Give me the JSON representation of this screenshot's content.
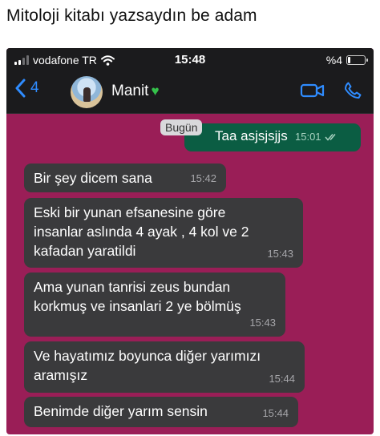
{
  "caption": "Mitoloji kitabı yazsaydın be adam",
  "status_bar": {
    "carrier": "vodafone TR",
    "time": "15:48",
    "battery": "%4"
  },
  "header": {
    "back_count": "4",
    "contact_name": "Manit",
    "accent_color": "#2f8cff"
  },
  "chat": {
    "day_label": "Bugün",
    "sent_message": {
      "text": "Taa asjsjsjjs",
      "time": "15:01"
    },
    "messages": [
      {
        "lines": [
          "Bir şey dicem sana"
        ],
        "time": "15:42"
      },
      {
        "lines": [
          "Eski bir yunan efsanesine göre",
          "insanlar aslında 4 ayak , 4 kol ve 2",
          "kafadan yaratildi"
        ],
        "time": "15:43"
      },
      {
        "lines": [
          "Ama yunan tanrisi zeus bundan",
          "korkmuş ve insanlari 2 ye bölmüş"
        ],
        "time": "15:43"
      },
      {
        "lines": [
          "Ve hayatımız boyunca diğer yarımızı",
          "aramışız"
        ],
        "time": "15:44"
      },
      {
        "lines": [
          "Benimde diğer yarım sensin"
        ],
        "time": "15:44"
      }
    ]
  }
}
